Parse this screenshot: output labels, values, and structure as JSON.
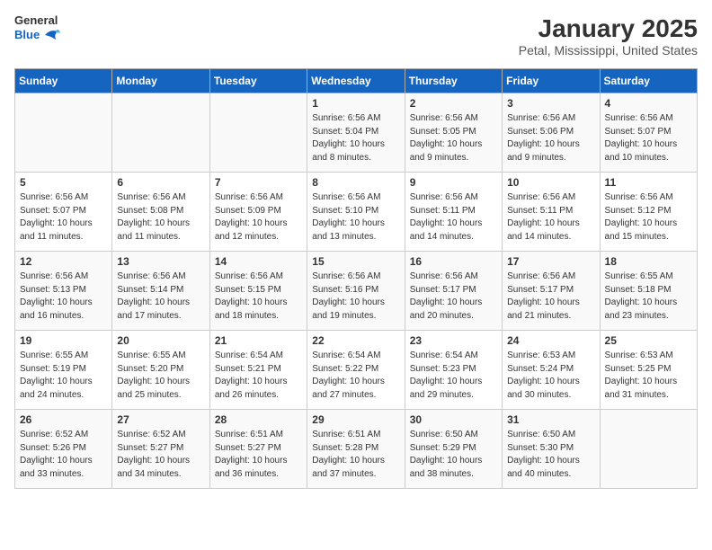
{
  "logo": {
    "general": "General",
    "blue": "Blue"
  },
  "title": "January 2025",
  "subtitle": "Petal, Mississippi, United States",
  "weekdays": [
    "Sunday",
    "Monday",
    "Tuesday",
    "Wednesday",
    "Thursday",
    "Friday",
    "Saturday"
  ],
  "weeks": [
    [
      {
        "day": "",
        "sunrise": "",
        "sunset": "",
        "daylight": ""
      },
      {
        "day": "",
        "sunrise": "",
        "sunset": "",
        "daylight": ""
      },
      {
        "day": "",
        "sunrise": "",
        "sunset": "",
        "daylight": ""
      },
      {
        "day": "1",
        "sunrise": "Sunrise: 6:56 AM",
        "sunset": "Sunset: 5:04 PM",
        "daylight": "Daylight: 10 hours and 8 minutes."
      },
      {
        "day": "2",
        "sunrise": "Sunrise: 6:56 AM",
        "sunset": "Sunset: 5:05 PM",
        "daylight": "Daylight: 10 hours and 9 minutes."
      },
      {
        "day": "3",
        "sunrise": "Sunrise: 6:56 AM",
        "sunset": "Sunset: 5:06 PM",
        "daylight": "Daylight: 10 hours and 9 minutes."
      },
      {
        "day": "4",
        "sunrise": "Sunrise: 6:56 AM",
        "sunset": "Sunset: 5:07 PM",
        "daylight": "Daylight: 10 hours and 10 minutes."
      }
    ],
    [
      {
        "day": "5",
        "sunrise": "Sunrise: 6:56 AM",
        "sunset": "Sunset: 5:07 PM",
        "daylight": "Daylight: 10 hours and 11 minutes."
      },
      {
        "day": "6",
        "sunrise": "Sunrise: 6:56 AM",
        "sunset": "Sunset: 5:08 PM",
        "daylight": "Daylight: 10 hours and 11 minutes."
      },
      {
        "day": "7",
        "sunrise": "Sunrise: 6:56 AM",
        "sunset": "Sunset: 5:09 PM",
        "daylight": "Daylight: 10 hours and 12 minutes."
      },
      {
        "day": "8",
        "sunrise": "Sunrise: 6:56 AM",
        "sunset": "Sunset: 5:10 PM",
        "daylight": "Daylight: 10 hours and 13 minutes."
      },
      {
        "day": "9",
        "sunrise": "Sunrise: 6:56 AM",
        "sunset": "Sunset: 5:11 PM",
        "daylight": "Daylight: 10 hours and 14 minutes."
      },
      {
        "day": "10",
        "sunrise": "Sunrise: 6:56 AM",
        "sunset": "Sunset: 5:11 PM",
        "daylight": "Daylight: 10 hours and 14 minutes."
      },
      {
        "day": "11",
        "sunrise": "Sunrise: 6:56 AM",
        "sunset": "Sunset: 5:12 PM",
        "daylight": "Daylight: 10 hours and 15 minutes."
      }
    ],
    [
      {
        "day": "12",
        "sunrise": "Sunrise: 6:56 AM",
        "sunset": "Sunset: 5:13 PM",
        "daylight": "Daylight: 10 hours and 16 minutes."
      },
      {
        "day": "13",
        "sunrise": "Sunrise: 6:56 AM",
        "sunset": "Sunset: 5:14 PM",
        "daylight": "Daylight: 10 hours and 17 minutes."
      },
      {
        "day": "14",
        "sunrise": "Sunrise: 6:56 AM",
        "sunset": "Sunset: 5:15 PM",
        "daylight": "Daylight: 10 hours and 18 minutes."
      },
      {
        "day": "15",
        "sunrise": "Sunrise: 6:56 AM",
        "sunset": "Sunset: 5:16 PM",
        "daylight": "Daylight: 10 hours and 19 minutes."
      },
      {
        "day": "16",
        "sunrise": "Sunrise: 6:56 AM",
        "sunset": "Sunset: 5:17 PM",
        "daylight": "Daylight: 10 hours and 20 minutes."
      },
      {
        "day": "17",
        "sunrise": "Sunrise: 6:56 AM",
        "sunset": "Sunset: 5:17 PM",
        "daylight": "Daylight: 10 hours and 21 minutes."
      },
      {
        "day": "18",
        "sunrise": "Sunrise: 6:55 AM",
        "sunset": "Sunset: 5:18 PM",
        "daylight": "Daylight: 10 hours and 23 minutes."
      }
    ],
    [
      {
        "day": "19",
        "sunrise": "Sunrise: 6:55 AM",
        "sunset": "Sunset: 5:19 PM",
        "daylight": "Daylight: 10 hours and 24 minutes."
      },
      {
        "day": "20",
        "sunrise": "Sunrise: 6:55 AM",
        "sunset": "Sunset: 5:20 PM",
        "daylight": "Daylight: 10 hours and 25 minutes."
      },
      {
        "day": "21",
        "sunrise": "Sunrise: 6:54 AM",
        "sunset": "Sunset: 5:21 PM",
        "daylight": "Daylight: 10 hours and 26 minutes."
      },
      {
        "day": "22",
        "sunrise": "Sunrise: 6:54 AM",
        "sunset": "Sunset: 5:22 PM",
        "daylight": "Daylight: 10 hours and 27 minutes."
      },
      {
        "day": "23",
        "sunrise": "Sunrise: 6:54 AM",
        "sunset": "Sunset: 5:23 PM",
        "daylight": "Daylight: 10 hours and 29 minutes."
      },
      {
        "day": "24",
        "sunrise": "Sunrise: 6:53 AM",
        "sunset": "Sunset: 5:24 PM",
        "daylight": "Daylight: 10 hours and 30 minutes."
      },
      {
        "day": "25",
        "sunrise": "Sunrise: 6:53 AM",
        "sunset": "Sunset: 5:25 PM",
        "daylight": "Daylight: 10 hours and 31 minutes."
      }
    ],
    [
      {
        "day": "26",
        "sunrise": "Sunrise: 6:52 AM",
        "sunset": "Sunset: 5:26 PM",
        "daylight": "Daylight: 10 hours and 33 minutes."
      },
      {
        "day": "27",
        "sunrise": "Sunrise: 6:52 AM",
        "sunset": "Sunset: 5:27 PM",
        "daylight": "Daylight: 10 hours and 34 minutes."
      },
      {
        "day": "28",
        "sunrise": "Sunrise: 6:51 AM",
        "sunset": "Sunset: 5:27 PM",
        "daylight": "Daylight: 10 hours and 36 minutes."
      },
      {
        "day": "29",
        "sunrise": "Sunrise: 6:51 AM",
        "sunset": "Sunset: 5:28 PM",
        "daylight": "Daylight: 10 hours and 37 minutes."
      },
      {
        "day": "30",
        "sunrise": "Sunrise: 6:50 AM",
        "sunset": "Sunset: 5:29 PM",
        "daylight": "Daylight: 10 hours and 38 minutes."
      },
      {
        "day": "31",
        "sunrise": "Sunrise: 6:50 AM",
        "sunset": "Sunset: 5:30 PM",
        "daylight": "Daylight: 10 hours and 40 minutes."
      },
      {
        "day": "",
        "sunrise": "",
        "sunset": "",
        "daylight": ""
      }
    ]
  ]
}
